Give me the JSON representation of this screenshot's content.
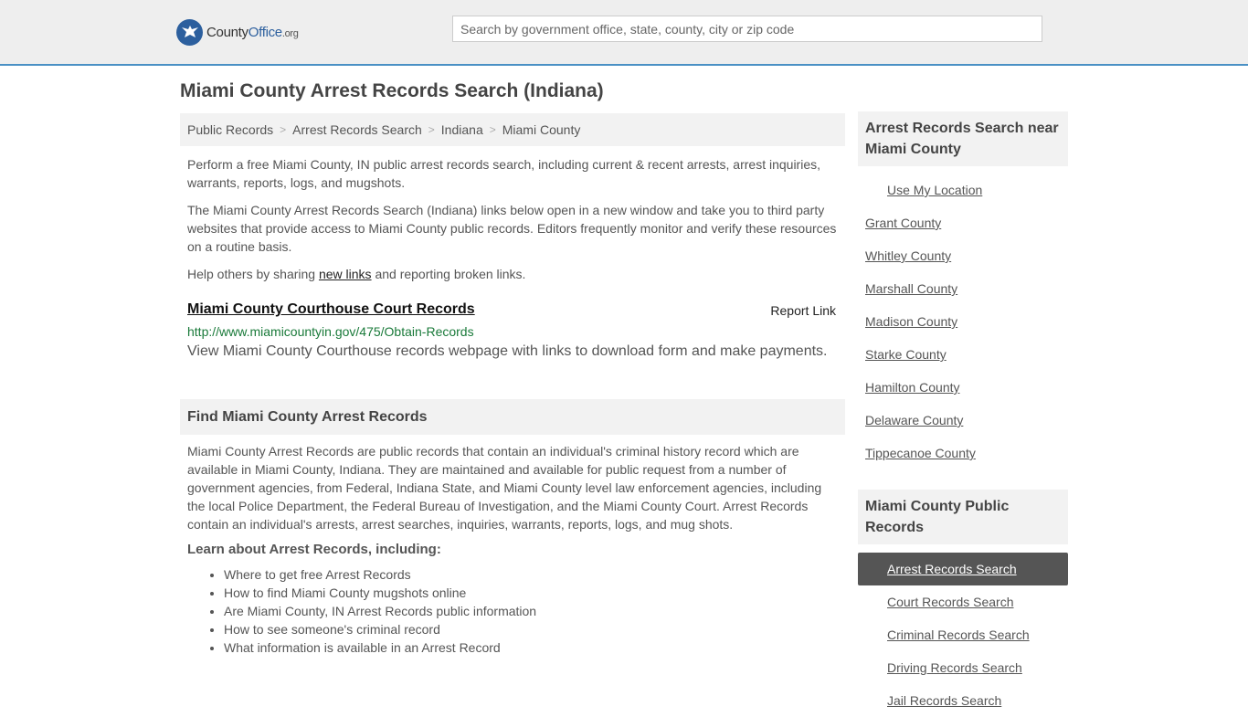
{
  "header": {
    "logo": {
      "county": "County",
      "office": "Office",
      "org": ".org"
    },
    "search_placeholder": "Search by government office, state, county, city or zip code"
  },
  "page_title": "Miami County Arrest Records Search (Indiana)",
  "breadcrumb": [
    "Public Records",
    "Arrest Records Search",
    "Indiana",
    "Miami County"
  ],
  "intro": {
    "p1": "Perform a free Miami County, IN public arrest records search, including current & recent arrests, arrest inquiries, warrants, reports, logs, and mugshots.",
    "p2": "The Miami County Arrest Records Search (Indiana) links below open in a new window and take you to third party websites that provide access to Miami County public records. Editors frequently monitor and verify these resources on a routine basis.",
    "p3_before": "Help others by sharing ",
    "p3_link": "new links",
    "p3_after": " and reporting broken links."
  },
  "record": {
    "title": "Miami County Courthouse Court Records",
    "report": "Report Link",
    "url": "http://www.miamicountyin.gov/475/Obtain-Records",
    "desc": "View Miami County Courthouse records webpage with links to download form and make payments."
  },
  "find": {
    "heading": "Find Miami County Arrest Records",
    "body": "Miami County Arrest Records are public records that contain an individual's criminal history record which are available in Miami County, Indiana. They are maintained and available for public request from a number of government agencies, from Federal, Indiana State, and Miami County level law enforcement agencies, including the local Police Department, the Federal Bureau of Investigation, and the Miami County Court. Arrest Records contain an individual's arrests, arrest searches, inquiries, warrants, reports, logs, and mug shots.",
    "learn": "Learn about Arrest Records, including:",
    "items": [
      "Where to get free Arrest Records",
      "How to find Miami County mugshots online",
      "Are Miami County, IN Arrest Records public information",
      "How to see someone's criminal record",
      "What information is available in an Arrest Record"
    ]
  },
  "sidebar": {
    "near_heading": "Arrest Records Search near Miami County",
    "use_location": "Use My Location",
    "counties": [
      "Grant County",
      "Whitley County",
      "Marshall County",
      "Madison County",
      "Starke County",
      "Hamilton County",
      "Delaware County",
      "Tippecanoe County"
    ],
    "public_heading": "Miami County Public Records",
    "public_links": [
      "Arrest Records Search",
      "Court Records Search",
      "Criminal Records Search",
      "Driving Records Search",
      "Jail Records Search"
    ]
  }
}
